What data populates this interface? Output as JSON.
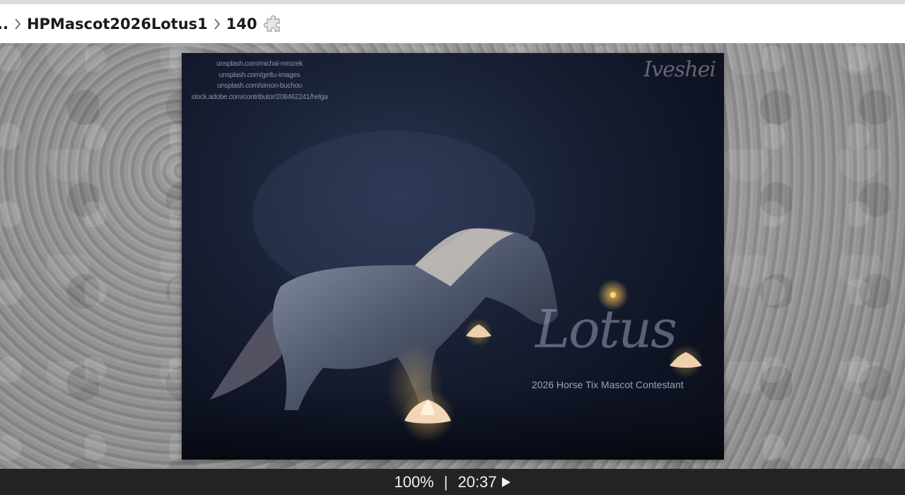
{
  "breadcrumb": {
    "ellipsis": "..",
    "folder": "HPMascot2026Lotus1",
    "item": "140"
  },
  "artwork": {
    "credits": [
      "unsplash.com/michal-mrozek",
      "unsplash.com/gettu-images",
      "unsplash.com/simon-buchou",
      "stock.adobe.com/contributor/208462241/helga"
    ],
    "signature": "Iveshei",
    "title": "Lotus",
    "subtitle": "2026 Horse Tix Mascot Contestant"
  },
  "status": {
    "zoom": "100%",
    "separator": "|",
    "time": "20:37"
  },
  "icons": {
    "breadcrumb_separator": "chevron-right-icon",
    "puzzle": "puzzle-icon",
    "play": "play-icon"
  }
}
